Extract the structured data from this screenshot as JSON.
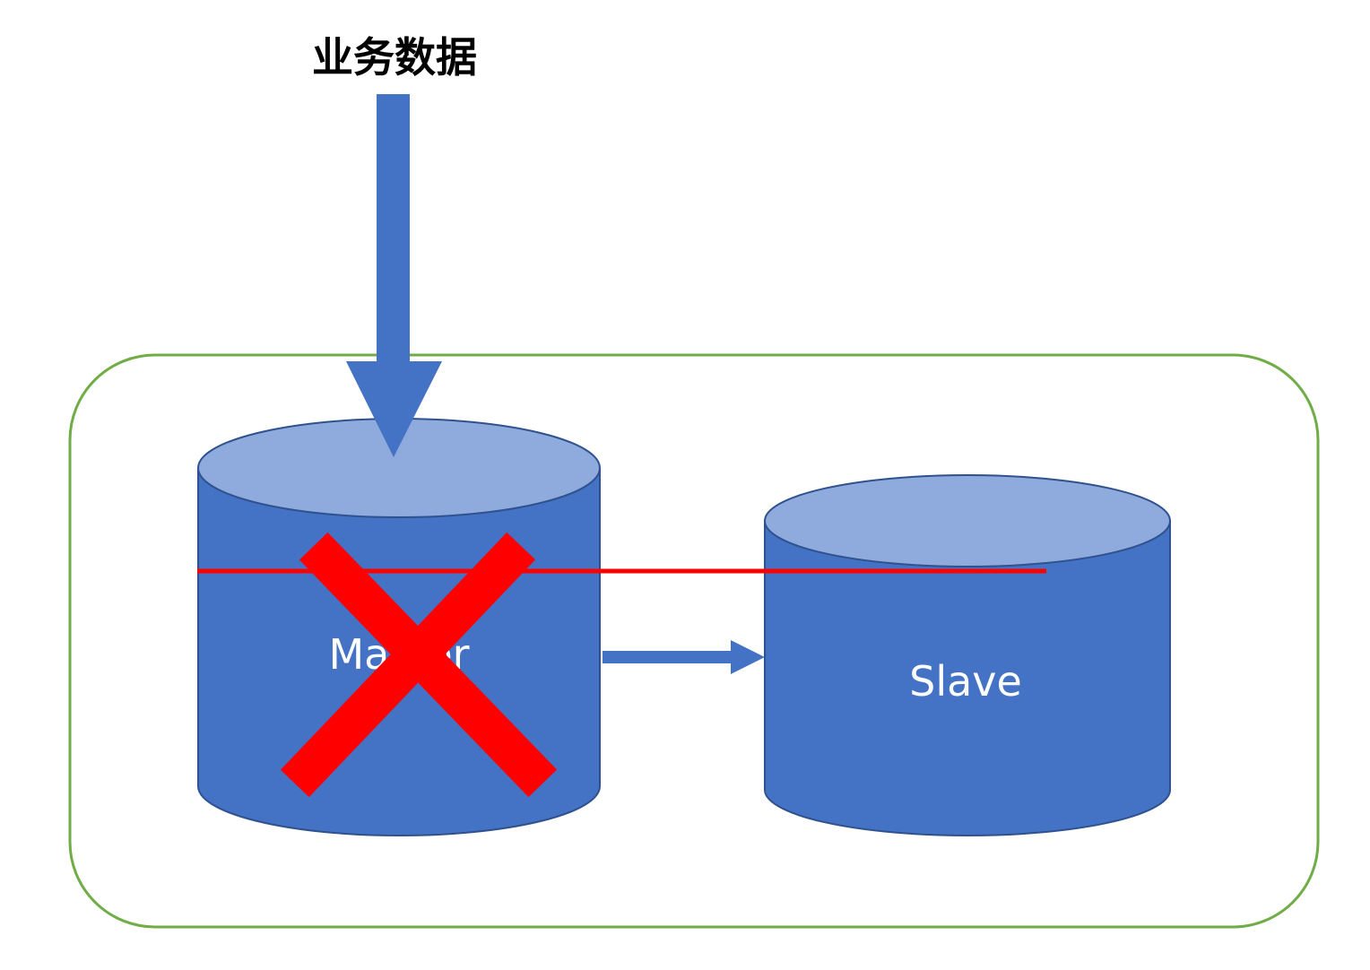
{
  "diagram": {
    "input_label": "业务数据",
    "master_label": "Master",
    "slave_label": "Slave",
    "colors": {
      "cylinder_body": "#4472c4",
      "cylinder_top": "#8faadc",
      "cylinder_stroke": "#2f528f",
      "arrow": "#4472c4",
      "container_border": "#70ad47",
      "failure_mark": "#ff0000"
    },
    "master_status": "failed",
    "replication": {
      "from": "Master",
      "to": "Slave"
    }
  }
}
